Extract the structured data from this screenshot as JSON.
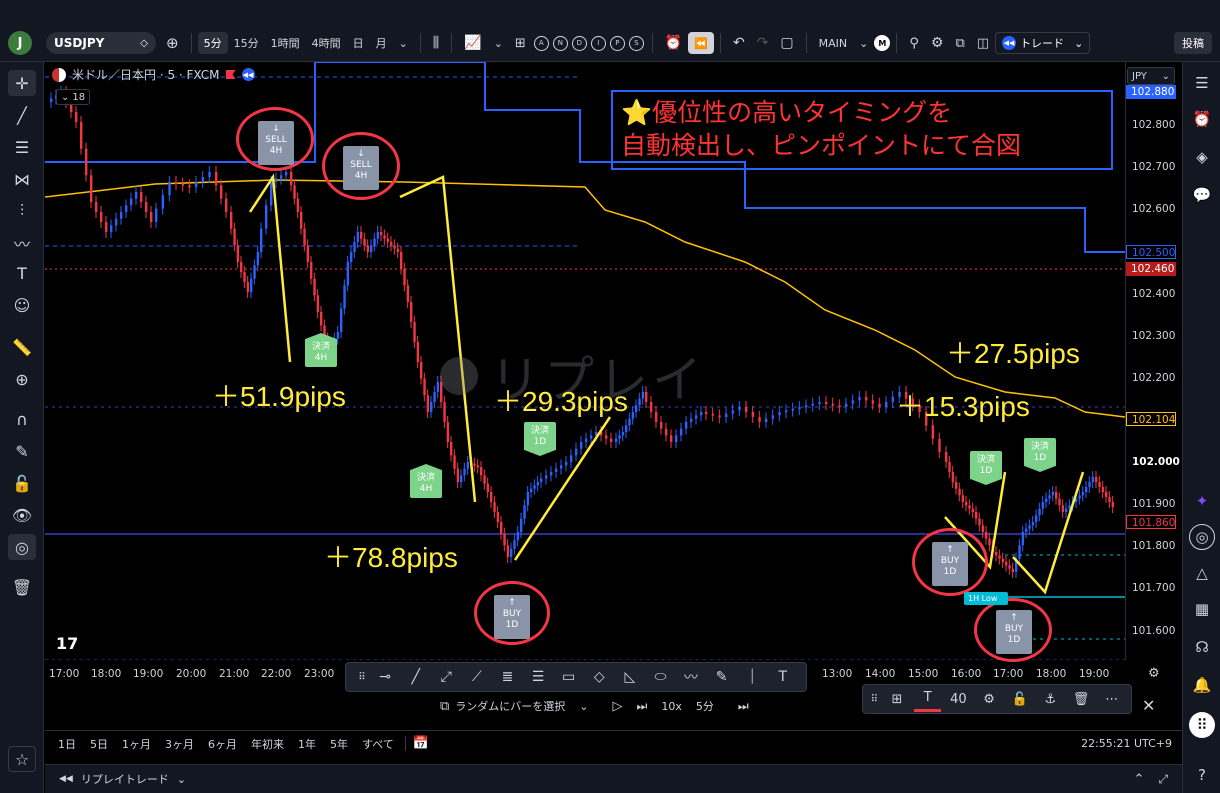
{
  "toolbar": {
    "avatar": "J",
    "symbol": "USDJPY",
    "intervals": [
      "5分",
      "15分",
      "1時間",
      "4時間",
      "日",
      "月"
    ],
    "active_interval": "5分",
    "letters": [
      "A",
      "N",
      "D",
      "I",
      "P",
      "S"
    ],
    "layout_name": "MAIN",
    "m_badge": "M",
    "trade_label": "トレード",
    "post_label": "投稿"
  },
  "legend": {
    "title": "米ドル／日本円 · 5 · FXCM",
    "collapse_count": "18"
  },
  "caption": {
    "line1": "⭐優位性の高いタイミングを",
    "line2": "自動検出し、ピンポイントにて合図"
  },
  "pips_labels": [
    "＋51.9pips",
    "＋29.3pips",
    "＋78.8pips",
    "＋27.5pips",
    "＋15.3pips"
  ],
  "signals": {
    "sell_4h_a": {
      "arrow": "↓",
      "side": "SELL",
      "tf": "4H"
    },
    "sell_4h_b": {
      "arrow": "↓",
      "side": "SELL",
      "tf": "4H"
    },
    "buy_1d_a": {
      "arrow": "↑",
      "side": "BUY",
      "tf": "1D"
    },
    "buy_1d_b": {
      "arrow": "↑",
      "side": "BUY",
      "tf": "1D"
    },
    "buy_1d_c": {
      "arrow": "↑",
      "side": "BUY",
      "tf": "1D"
    },
    "settle_4h_a": {
      "label": "決済",
      "tf": "4H"
    },
    "settle_4h_b": {
      "label": "決済",
      "tf": "4H"
    },
    "settle_1d_a": {
      "label": "決済",
      "tf": "1D"
    },
    "settle_1d_b": {
      "label": "決済",
      "tf": "1D"
    },
    "settle_1d_c": {
      "label": "決済",
      "tf": "1D"
    }
  },
  "watermark": "リプレイ",
  "lowline_label": "1H Low",
  "price_axis": {
    "currency": "JPY",
    "ticks": [
      "102.800",
      "102.700",
      "102.600",
      "102.400",
      "102.300",
      "102.200",
      "101.900",
      "101.800",
      "101.700",
      "101.600"
    ],
    "labels": {
      "top": "102.880",
      "blue": "102.500",
      "red": "102.460",
      "yellow": "102.104",
      "current": "102.000",
      "last": "101.860"
    }
  },
  "time_axis": [
    "17:00",
    "18:00",
    "19:00",
    "20:00",
    "21:00",
    "22:00",
    "23:00",
    "13:00",
    "14:00",
    "15:00",
    "16:00",
    "17:00",
    "18:00",
    "19:00"
  ],
  "draw_text_size": "40",
  "replay": {
    "random_bar": "ランダムにバーを選択",
    "speed": "10x",
    "step": "5分"
  },
  "ranges": [
    "1日",
    "5日",
    "1ヶ月",
    "3ヶ月",
    "6ヶ月",
    "年初来",
    "1年",
    "5年",
    "すべて"
  ],
  "clock": "22:55:21 UTC+9",
  "footer": {
    "label": "リプレイトレード"
  },
  "colors": {
    "blue_line": "#2962ff",
    "yellow_line": "#ffc107",
    "red_dotted": "#f23645",
    "pips_text": "#ffeb3b",
    "caption_text": "#ff3333",
    "bull": "#2962ff",
    "bear": "#f23645"
  }
}
